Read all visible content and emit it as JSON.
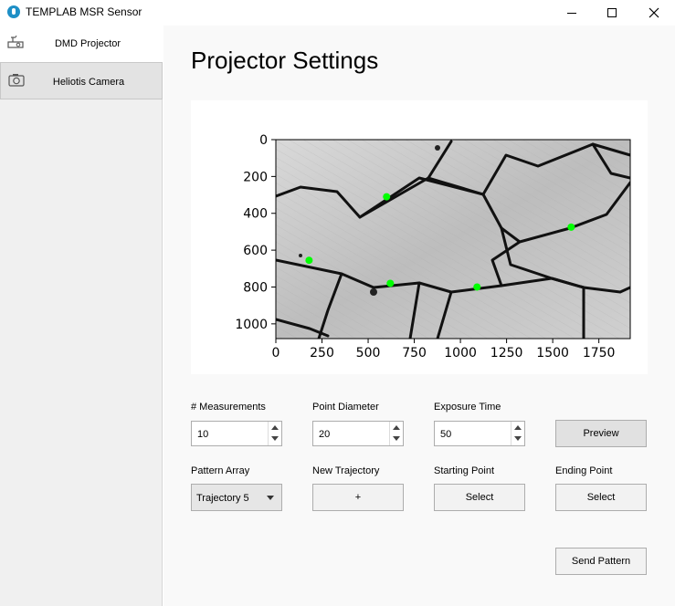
{
  "window": {
    "title": "TEMPLAB MSR Sensor",
    "icons": {
      "app": "app-icon",
      "minimize": "minimize-icon",
      "maximize": "maximize-icon",
      "close": "close-icon"
    }
  },
  "sidebar": {
    "items": [
      {
        "label": "DMD Projector",
        "icon": "projector-icon"
      },
      {
        "label": "Heliotis Camera",
        "icon": "camera-icon"
      }
    ]
  },
  "main": {
    "title": "Projector Settings",
    "fields": {
      "measurements": {
        "label": "# Measurements",
        "value": "10"
      },
      "point_diameter": {
        "label": "Point Diameter",
        "value": "20"
      },
      "exposure_time": {
        "label": "Exposure Time",
        "value": "50"
      },
      "preview_label": "Preview",
      "pattern_array": {
        "label": "Pattern Array",
        "value": "Trajectory 5"
      },
      "new_trajectory": {
        "label": "New Trajectory",
        "button": "+"
      },
      "starting_point": {
        "label": "Starting Point",
        "button": "Select"
      },
      "ending_point": {
        "label": "Ending Point",
        "button": "Select"
      },
      "send_label": "Send Pattern"
    }
  },
  "chart_data": {
    "type": "scatter",
    "background": "grayscale microscope image of grain structure",
    "xlim": [
      0,
      1920
    ],
    "ylim": [
      1080,
      0
    ],
    "xticks": [
      0,
      250,
      500,
      750,
      1000,
      1250,
      1500,
      1750
    ],
    "yticks": [
      0,
      200,
      400,
      600,
      800,
      1000
    ],
    "point_color": "#00ff00",
    "points": [
      {
        "x": 600,
        "y": 310
      },
      {
        "x": 1600,
        "y": 475
      },
      {
        "x": 180,
        "y": 655
      },
      {
        "x": 620,
        "y": 780
      },
      {
        "x": 1090,
        "y": 800
      }
    ]
  }
}
